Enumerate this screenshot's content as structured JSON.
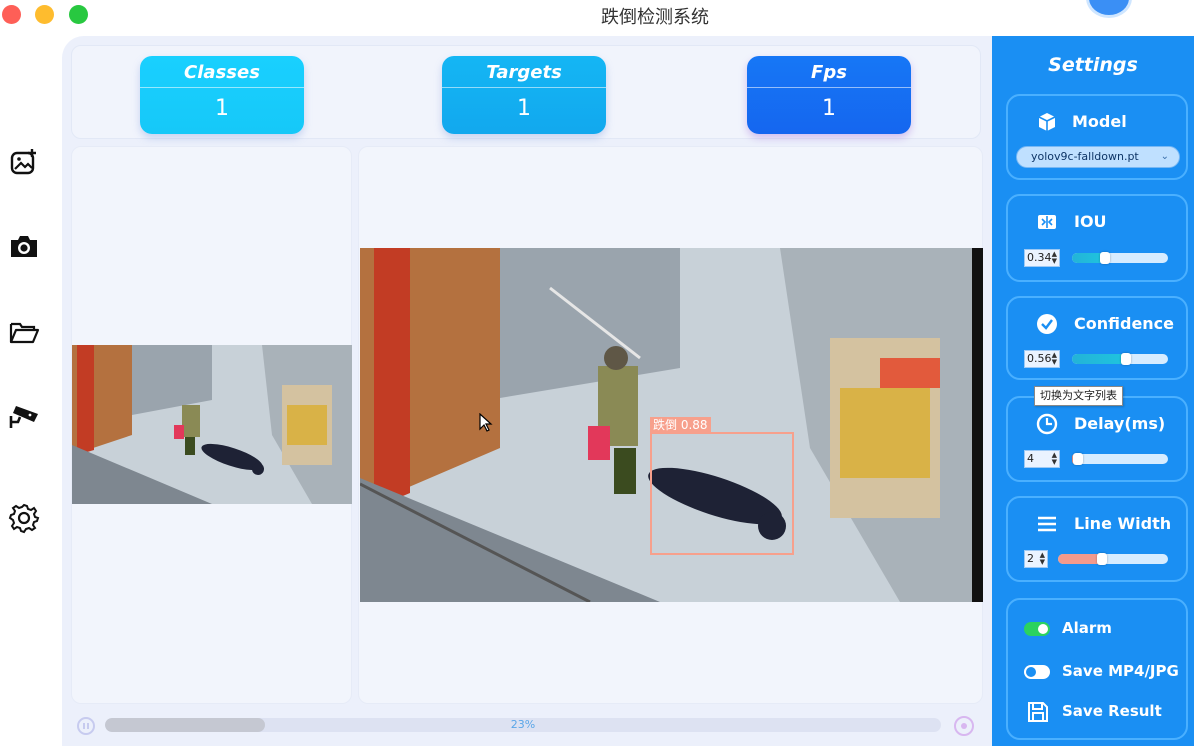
{
  "window": {
    "title": "跌倒检测系统"
  },
  "nav": {
    "items": [
      {
        "name": "image-add-icon"
      },
      {
        "name": "camera-icon"
      },
      {
        "name": "folder-open-icon"
      },
      {
        "name": "cctv-camera-icon"
      },
      {
        "name": "gear-icon"
      }
    ]
  },
  "stats": {
    "classes": {
      "label": "Classes",
      "value": "1"
    },
    "targets": {
      "label": "Targets",
      "value": "1"
    },
    "fps": {
      "label": "Fps",
      "value": "1"
    }
  },
  "detection": {
    "label": "跌倒 0.88",
    "color": "#f7a08c"
  },
  "progress": {
    "percent_label": "23%",
    "fraction": 0.23
  },
  "settings": {
    "title": "Settings",
    "model": {
      "label": "Model",
      "selected": "yolov9c-falldown.pt"
    },
    "iou": {
      "label": "IOU",
      "value": "0.34",
      "fraction": 0.34
    },
    "confidence": {
      "label": "Confidence",
      "value": "0.56",
      "fraction": 0.56
    },
    "delay": {
      "label": "Delay(ms)",
      "value": "4",
      "fraction": 0.04
    },
    "line_width": {
      "label": "Line Width",
      "value": "2",
      "fraction": 0.4
    },
    "alarm": {
      "label": "Alarm",
      "on": true
    },
    "save_media": {
      "label": "Save MP4/JPG",
      "on": false
    },
    "save_result": {
      "label": "Save Result"
    }
  },
  "tooltip": {
    "text": "切换为文字列表"
  },
  "colors": {
    "accent": "#1a8ff3",
    "slider_fill_iou": "#1fc4de",
    "slider_fill_conf": "#1fc4de",
    "slider_fill_delay": "#f39a8c",
    "slider_fill_line": "#f39a8c",
    "toggle_on": "#2bd25f"
  }
}
